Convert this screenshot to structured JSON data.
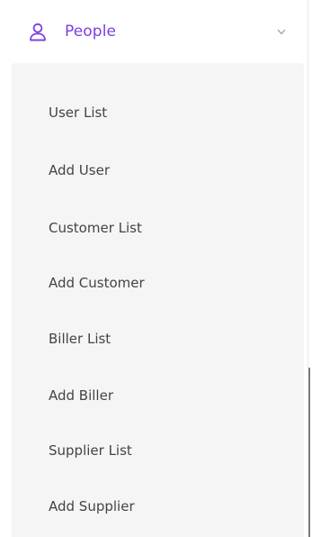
{
  "menu": {
    "title": "People",
    "icon": "user-icon",
    "chevron": "chevron-down-icon",
    "accent_color": "#7b3fe4",
    "items": [
      {
        "label": "User List"
      },
      {
        "label": "Add User"
      },
      {
        "label": "Customer List"
      },
      {
        "label": "Add Customer"
      },
      {
        "label": "Biller List"
      },
      {
        "label": "Add Biller"
      },
      {
        "label": "Supplier List"
      },
      {
        "label": "Add Supplier"
      }
    ]
  }
}
